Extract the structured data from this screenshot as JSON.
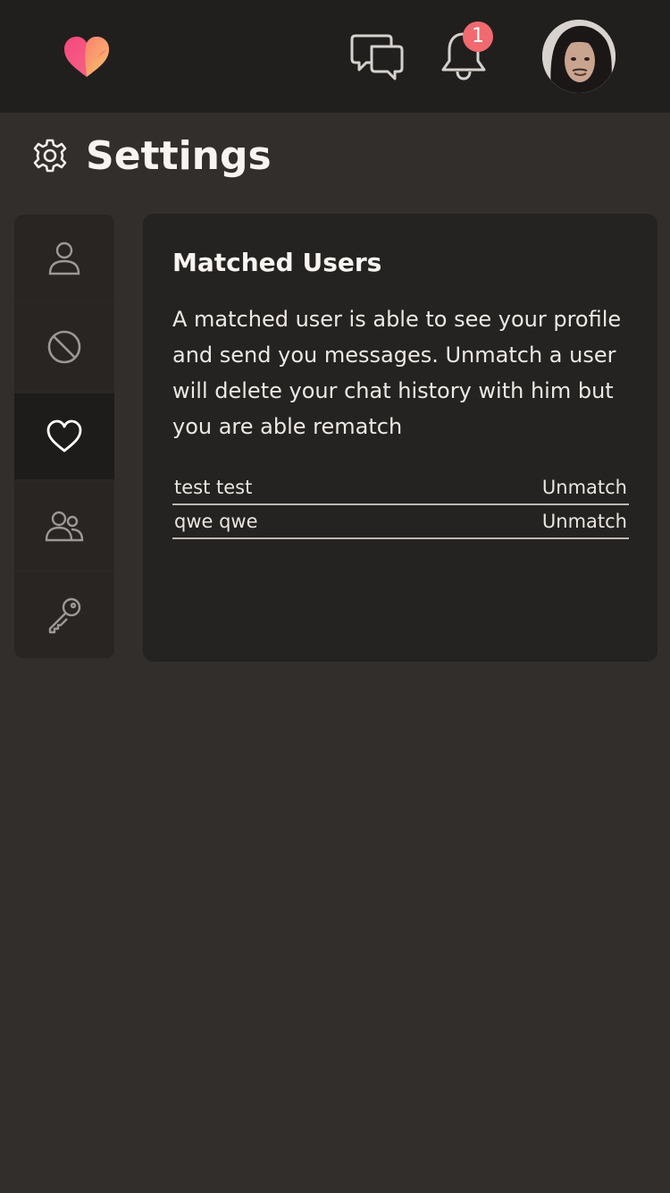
{
  "topbar": {
    "logo_icon": "heart-logo-icon",
    "chat_icon": "chat-bubbles-icon",
    "bell_icon": "bell-icon",
    "notification_count": "1",
    "avatar_icon": "user-avatar"
  },
  "page": {
    "title": "Settings",
    "icon": "gear-icon"
  },
  "sidebar": {
    "items": [
      {
        "icon": "user-icon",
        "active": false
      },
      {
        "icon": "block-icon",
        "active": false
      },
      {
        "icon": "heart-icon",
        "active": true
      },
      {
        "icon": "users-icon",
        "active": false
      },
      {
        "icon": "key-icon",
        "active": false
      }
    ]
  },
  "card": {
    "title": "Matched Users",
    "description": "A matched user is able to see your profile and send you messages. Unmatch a user will delete your chat history with him but you are able rematch",
    "rows": [
      {
        "name": "test test",
        "action": "Unmatch"
      },
      {
        "name": "qwe qwe",
        "action": "Unmatch"
      }
    ]
  },
  "colors": {
    "background": "#322e2c",
    "topbar": "#211f1e",
    "card": "#252321",
    "badge": "#f06a6f",
    "logo_pink": "#f4487e",
    "logo_orange": "#f9c26b"
  }
}
